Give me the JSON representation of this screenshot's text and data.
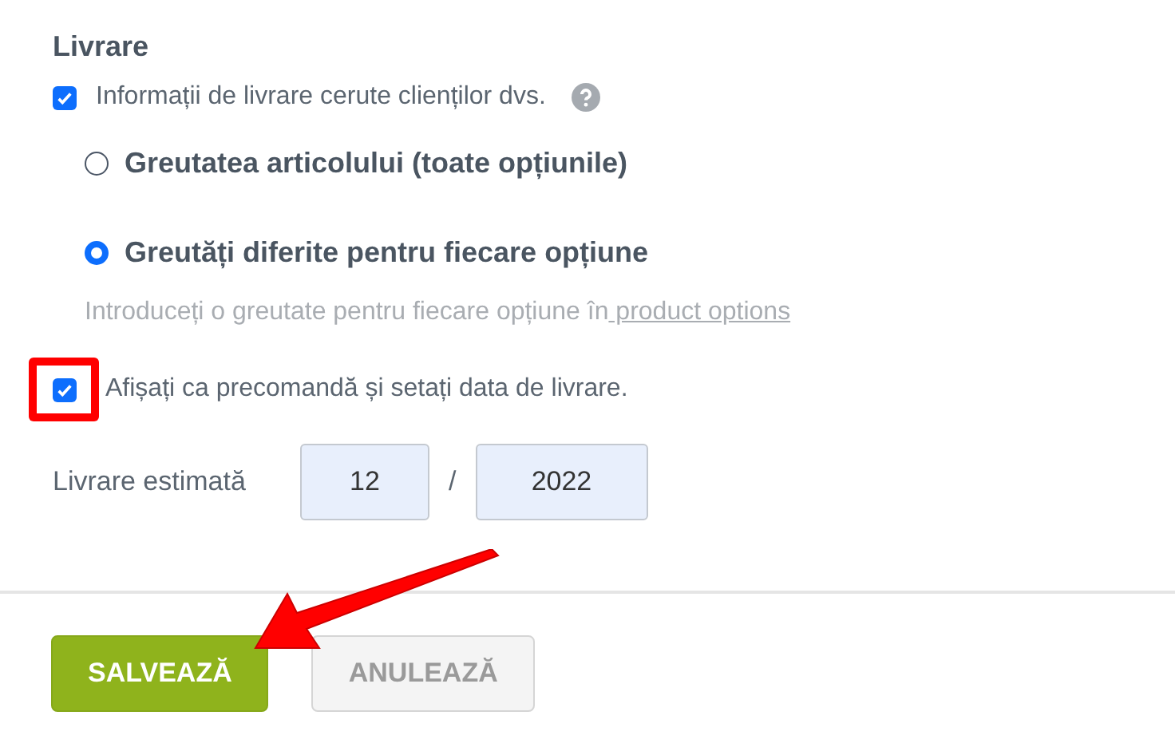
{
  "section_title": "Livrare",
  "shipping_info": {
    "label": "Informații de livrare cerute clienților dvs.",
    "checked": true
  },
  "weight_options": [
    {
      "label": "Greutatea articolului (toate opțiunile)",
      "selected": false
    },
    {
      "label": "Greutăți diferite pentru fiecare opțiune",
      "selected": true
    }
  ],
  "hint": {
    "text": "Introduceți o greutate pentru fiecare opțiune în",
    "link": " product options"
  },
  "preorder": {
    "label": "Afișați ca precomandă și setați data de livrare.",
    "checked": true,
    "highlighted": true
  },
  "estimated_delivery": {
    "label": "Livrare estimată",
    "month": "12",
    "separator": "/",
    "year": "2022"
  },
  "buttons": [
    {
      "label": "SALVEAZĂ",
      "kind": "primary"
    },
    {
      "label": "ANULEAZĂ",
      "kind": "secondary"
    }
  ]
}
